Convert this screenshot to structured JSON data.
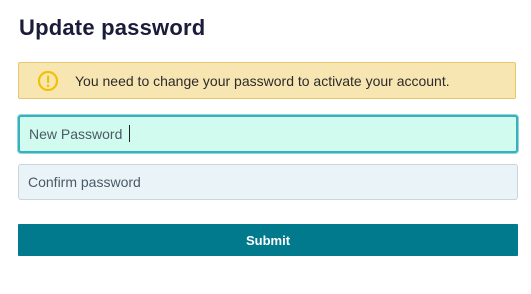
{
  "form": {
    "title": "Update password",
    "alert": {
      "icon": "warning-circle-icon",
      "text": "You need to change your password to activate your account.",
      "background": "#f8e6b2",
      "icon_color": "#f2c200"
    },
    "new_password": {
      "placeholder": "New Password",
      "value": "",
      "focused": true
    },
    "confirm_password": {
      "placeholder": "Confirm password",
      "value": ""
    },
    "submit_label": "Submit",
    "accent_color": "#017a8d"
  }
}
